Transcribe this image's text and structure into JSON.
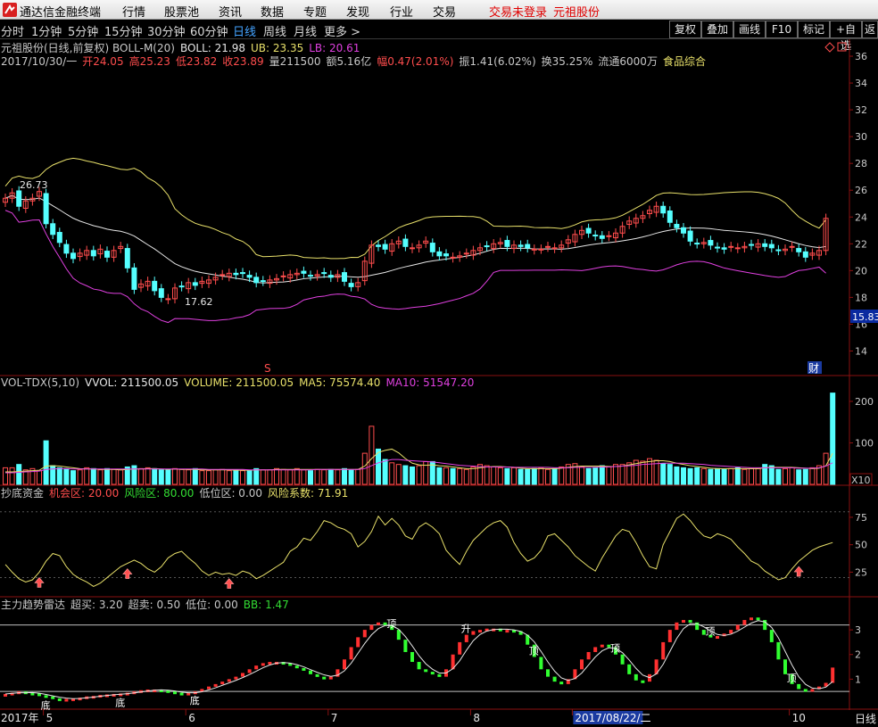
{
  "app": {
    "name": "通达信金融终端",
    "menu": [
      "行情",
      "股票池",
      "资讯",
      "数据",
      "专题",
      "发现",
      "行业",
      "交易"
    ],
    "login_status": "交易未登录",
    "stock_name": "元祖股份"
  },
  "toolbar": {
    "timeframes": [
      "分时",
      "1分钟",
      "5分钟",
      "15分钟",
      "30分钟",
      "60分钟",
      "日线",
      "周线",
      "月线",
      "更多 >"
    ],
    "active_timeframe": "日线",
    "buttons": [
      "复权",
      "叠加",
      "画线",
      "F10",
      "标记",
      "+自选",
      "返"
    ],
    "colors": {
      "active": "#44a3ff"
    }
  },
  "main_panel": {
    "info_line1": [
      {
        "text": "元祖股份(日线,前复权) BOLL-M(20)",
        "color": "#c8c8c8"
      },
      {
        "text": "BOLL: 21.98",
        "color": "#e6e6e6"
      },
      {
        "text": "UB: 23.35",
        "color": "#e8e06a"
      },
      {
        "text": "LB: 20.61",
        "color": "#e040e0"
      }
    ],
    "info_line2": [
      {
        "text": "2017/10/30/一",
        "color": "#c8c8c8"
      },
      {
        "text": "开24.05",
        "color": "#ff4d4d"
      },
      {
        "text": "高25.23",
        "color": "#ff4d4d"
      },
      {
        "text": "低23.82",
        "color": "#ff4d4d"
      },
      {
        "text": "收23.89",
        "color": "#ff4d4d"
      },
      {
        "text": "量211500",
        "color": "#c8c8c8"
      },
      {
        "text": "额5.16亿",
        "color": "#c8c8c8"
      },
      {
        "text": "幅0.47(2.01%)",
        "color": "#ff4d4d"
      },
      {
        "text": "振1.41(6.02%)",
        "color": "#c8c8c8"
      },
      {
        "text": "换35.25%",
        "color": "#c8c8c8"
      },
      {
        "text": "流通6000万",
        "color": "#c8c8c8"
      },
      {
        "text": "食品综合",
        "color": "#e8e06a"
      }
    ],
    "high_marker": "26.73",
    "low_marker": "17.62",
    "price_tag": "15.83",
    "s_marker": "S",
    "cai_marker": "财"
  },
  "volume_panel": {
    "info": [
      {
        "text": "VOL-TDX(5,10)",
        "color": "#c8c8c8"
      },
      {
        "text": "VVOL: 211500.05",
        "color": "#e6e6e6"
      },
      {
        "text": "VOLUME: 211500.05",
        "color": "#e8e06a"
      },
      {
        "text": "MA5: 75574.40",
        "color": "#e8e06a"
      },
      {
        "text": "MA10: 51547.20",
        "color": "#e040e0"
      }
    ],
    "unit": "X10"
  },
  "chaodi_panel": {
    "info": [
      {
        "text": "抄底资金",
        "color": "#c8c8c8"
      },
      {
        "text": "机会区: 20.00",
        "color": "#ff4d4d"
      },
      {
        "text": "风险区: 80.00",
        "color": "#33dd33"
      },
      {
        "text": "低位区: 0.00",
        "color": "#c8c8c8"
      },
      {
        "text": "风险系数: 71.91",
        "color": "#e8e06a"
      }
    ]
  },
  "trend_panel": {
    "info": [
      {
        "text": "主力趋势雷达",
        "color": "#c8c8c8"
      },
      {
        "text": "超买: 3.20",
        "color": "#c8c8c8"
      },
      {
        "text": "超卖: 0.50",
        "color": "#c8c8c8"
      },
      {
        "text": "低位: 0.00",
        "color": "#c8c8c8"
      },
      {
        "text": "BB: 1.47",
        "color": "#33dd33"
      }
    ],
    "labels": [
      {
        "text": "底",
        "x": 6
      },
      {
        "text": "底",
        "x": 17
      },
      {
        "text": "底",
        "x": 28
      },
      {
        "text": "顶",
        "x": 57
      },
      {
        "text": "升",
        "x": 68
      },
      {
        "text": "顶",
        "x": 78
      },
      {
        "text": "顶",
        "x": 90
      },
      {
        "text": "顶",
        "x": 104
      },
      {
        "text": "顶",
        "x": 116
      }
    ]
  },
  "time_axis": {
    "labels": [
      {
        "text": "2017年",
        "x": 0
      },
      {
        "text": "5",
        "x": 6
      },
      {
        "text": "6",
        "x": 27
      },
      {
        "text": "7",
        "x": 48
      },
      {
        "text": "8",
        "x": 69
      },
      {
        "text": "2017/08/22/二",
        "x": 84
      },
      {
        "text": "10",
        "x": 116
      }
    ],
    "right_label": "日线"
  },
  "chart_data": [
    {
      "type": "candlestick",
      "title": "元祖股份(日线,前复权) BOLL-M(20)",
      "ylim": [
        12.5,
        37
      ],
      "y_ticks": [
        14,
        16,
        18,
        20,
        22,
        24,
        26,
        28,
        30,
        32,
        34,
        36
      ],
      "closes": [
        25.4,
        25.8,
        24.8,
        25.2,
        25.4,
        25.9,
        23.5,
        22.7,
        22.1,
        21.3,
        20.9,
        21.3,
        21.5,
        21.1,
        21.6,
        21.0,
        21.5,
        21.8,
        20.2,
        18.6,
        19.0,
        19.2,
        18.5,
        18.0,
        17.9,
        18.7,
        18.8,
        19.1,
        18.9,
        19.2,
        19.3,
        19.5,
        19.7,
        19.8,
        19.7,
        19.8,
        19.5,
        19.1,
        19.2,
        19.3,
        19.4,
        19.6,
        19.7,
        19.8,
        19.8,
        19.6,
        19.7,
        19.8,
        19.5,
        19.7,
        19.2,
        18.8,
        19.1,
        20.7,
        21.9,
        21.8,
        21.6,
        22.0,
        22.2,
        21.8,
        21.7,
        21.9,
        22.2,
        21.4,
        21.1,
        21.1,
        21.0,
        21.1,
        21.3,
        21.5,
        21.7,
        21.8,
        22.0,
        22.1,
        21.8,
        21.9,
        21.8,
        21.7,
        21.6,
        21.6,
        21.8,
        21.7,
        21.9,
        22.3,
        22.7,
        23.0,
        22.8,
        22.6,
        22.4,
        22.6,
        22.8,
        23.3,
        23.7,
        23.9,
        24.1,
        24.5,
        24.8,
        24.3,
        23.6,
        23.2,
        22.8,
        22.2,
        22.0,
        22.1,
        21.9,
        21.7,
        21.6,
        21.8,
        21.7,
        21.8,
        21.9,
        22.0,
        21.8,
        21.7,
        21.5,
        21.6,
        21.8,
        21.4,
        21.0,
        21.3,
        21.5,
        23.9
      ],
      "volume": {
        "ylim": [
          0,
          230
        ],
        "y_ticks": [
          100,
          200
        ],
        "values": [
          40,
          40,
          48,
          35,
          38,
          33,
          105,
          45,
          40,
          38,
          33,
          35,
          40,
          38,
          35,
          38,
          36,
          35,
          42,
          45,
          38,
          40,
          38,
          35,
          35,
          38,
          36,
          35,
          38,
          33,
          33,
          35,
          36,
          33,
          35,
          33,
          33,
          38,
          35,
          35,
          38,
          36,
          35,
          38,
          35,
          33,
          36,
          35,
          36,
          35,
          38,
          35,
          36,
          75,
          140,
          85,
          60,
          52,
          48,
          45,
          42,
          45,
          55,
          55,
          40,
          40,
          38,
          38,
          36,
          42,
          48,
          45,
          42,
          40,
          38,
          40,
          36,
          36,
          38,
          40,
          36,
          38,
          42,
          48,
          50,
          42,
          38,
          40,
          45,
          42,
          48,
          48,
          52,
          58,
          56,
          62,
          58,
          50,
          48,
          42,
          40,
          38,
          40,
          38,
          36,
          38,
          36,
          38,
          40,
          36,
          38,
          38,
          48,
          45,
          36,
          38,
          40,
          35,
          36,
          40,
          45,
          75,
          220
        ],
        "ma5": [
          30,
          30,
          31,
          32,
          33,
          34,
          44,
          45,
          44,
          42,
          40,
          38,
          37,
          37,
          36,
          36,
          36,
          35,
          36,
          37,
          37,
          38,
          38,
          37,
          36,
          37,
          36,
          36,
          36,
          35,
          35,
          35,
          35,
          35,
          34,
          34,
          34,
          35,
          35,
          35,
          36,
          36,
          36,
          36,
          36,
          36,
          36,
          36,
          36,
          36,
          36,
          36,
          36,
          44,
          62,
          77,
          82,
          85,
          76,
          62,
          51,
          47,
          46,
          47,
          45,
          44,
          42,
          40,
          38,
          38,
          40,
          42,
          43,
          43,
          42,
          41,
          39,
          38,
          38,
          38,
          38,
          38,
          39,
          41,
          43,
          44,
          44,
          44,
          44,
          43,
          43,
          44,
          47,
          50,
          53,
          55,
          57,
          57,
          55,
          51,
          48,
          45,
          43,
          41,
          39,
          38,
          38,
          38,
          38,
          38,
          38,
          38,
          40,
          41,
          41,
          41,
          41,
          40,
          39,
          38,
          39,
          45,
          75
        ],
        "ma10": [
          28,
          28,
          29,
          30,
          31,
          32,
          36,
          37,
          38,
          38,
          37,
          37,
          37,
          37,
          37,
          37,
          37,
          37,
          37,
          37,
          37,
          37,
          37,
          37,
          37,
          37,
          37,
          37,
          37,
          37,
          36,
          36,
          36,
          36,
          36,
          36,
          35,
          35,
          35,
          35,
          35,
          35,
          35,
          35,
          35,
          35,
          36,
          36,
          36,
          36,
          36,
          36,
          36,
          38,
          45,
          52,
          56,
          60,
          60,
          58,
          57,
          56,
          55,
          54,
          52,
          50,
          48,
          46,
          45,
          44,
          43,
          42,
          42,
          42,
          42,
          41,
          41,
          41,
          41,
          41,
          41,
          40,
          40,
          40,
          41,
          41,
          41,
          41,
          42,
          42,
          43,
          44,
          45,
          46,
          48,
          49,
          50,
          51,
          51,
          51,
          51,
          50,
          49,
          48,
          46,
          45,
          44,
          43,
          42,
          41,
          40,
          40,
          40,
          40,
          40,
          40,
          40,
          39,
          39,
          39,
          40,
          44,
          52
        ]
      }
    },
    {
      "type": "line",
      "title": "抄底资金",
      "ylim": [
        5,
        92
      ],
      "y_ticks": [
        25,
        50,
        75
      ],
      "series": [
        {
          "name": "风险系数",
          "values": [
            32,
            25,
            19,
            16,
            18,
            25,
            35,
            42,
            40,
            30,
            23,
            19,
            16,
            12,
            15,
            20,
            25,
            30,
            33,
            36,
            33,
            28,
            25,
            30,
            38,
            42,
            44,
            38,
            33,
            26,
            22,
            25,
            23,
            24,
            22,
            26,
            24,
            19,
            22,
            26,
            30,
            34,
            44,
            48,
            56,
            54,
            62,
            72,
            70,
            66,
            64,
            60,
            48,
            53,
            62,
            76,
            68,
            74,
            68,
            58,
            55,
            66,
            70,
            66,
            60,
            45,
            38,
            32,
            44,
            54,
            60,
            66,
            70,
            72,
            66,
            52,
            42,
            35,
            38,
            45,
            58,
            60,
            54,
            48,
            40,
            35,
            30,
            26,
            38,
            48,
            58,
            64,
            62,
            52,
            40,
            30,
            28,
            50,
            62,
            74,
            78,
            72,
            64,
            58,
            56,
            60,
            58,
            55,
            48,
            42,
            35,
            32,
            26,
            22,
            18,
            20,
            28,
            35,
            40,
            45,
            48,
            50,
            52
          ]
        }
      ],
      "arrows_at": [
        5,
        18,
        33,
        117
      ]
    },
    {
      "type": "bar",
      "title": "主力趋势雷达",
      "ylim": [
        0,
        3.8
      ],
      "y_ticks": [
        1,
        2,
        3
      ],
      "values": [
        0.4,
        0.45,
        0.5,
        0.45,
        0.42,
        0.35,
        0.3,
        0.22,
        0.2,
        0.2,
        0.22,
        0.25,
        0.3,
        0.32,
        0.36,
        0.38,
        0.4,
        0.42,
        0.45,
        0.5,
        0.55,
        0.58,
        0.58,
        0.55,
        0.5,
        0.45,
        0.4,
        0.45,
        0.5,
        0.6,
        0.7,
        0.8,
        0.9,
        1.0,
        1.1,
        1.25,
        1.4,
        1.55,
        1.65,
        1.7,
        1.7,
        1.65,
        1.55,
        1.45,
        1.35,
        1.2,
        1.1,
        1.05,
        1.1,
        1.4,
        1.8,
        2.3,
        2.7,
        3.0,
        3.2,
        3.3,
        3.2,
        3.0,
        2.6,
        2.1,
        1.7,
        1.4,
        1.3,
        1.2,
        1.1,
        1.4,
        2.0,
        2.5,
        2.8,
        2.95,
        3.0,
        3.05,
        3.05,
        3.0,
        3.0,
        2.95,
        2.8,
        2.4,
        1.9,
        1.4,
        1.1,
        0.9,
        0.8,
        1.0,
        1.4,
        1.8,
        2.1,
        2.3,
        2.4,
        2.3,
        2.0,
        1.6,
        1.2,
        0.95,
        0.9,
        1.2,
        1.8,
        2.5,
        3.0,
        3.3,
        3.4,
        3.3,
        3.0,
        2.8,
        2.7,
        2.75,
        2.85,
        3.0,
        3.2,
        3.4,
        3.5,
        3.4,
        3.0,
        2.5,
        1.8,
        1.2,
        0.8,
        0.6,
        0.55,
        0.6,
        0.7,
        0.85,
        1.47
      ]
    }
  ]
}
